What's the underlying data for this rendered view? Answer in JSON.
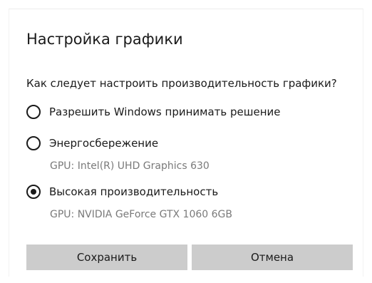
{
  "dialog": {
    "title": "Настройка графики",
    "question": "Как следует настроить производительность графики?",
    "options": [
      {
        "label": "Разрешить Windows принимать решение",
        "selected": false,
        "gpu": ""
      },
      {
        "label": "Энергосбережение",
        "selected": false,
        "gpu": "GPU: Intel(R) UHD Graphics 630"
      },
      {
        "label": "Высокая производительность",
        "selected": true,
        "gpu": "GPU: NVIDIA GeForce GTX 1060 6GB"
      }
    ],
    "buttons": {
      "save": "Сохранить",
      "cancel": "Отмена"
    }
  },
  "colors": {
    "text": "#1a1a1a",
    "secondary_text": "#7a7a7a",
    "button_bg": "#cccccc",
    "background": "#ffffff"
  }
}
